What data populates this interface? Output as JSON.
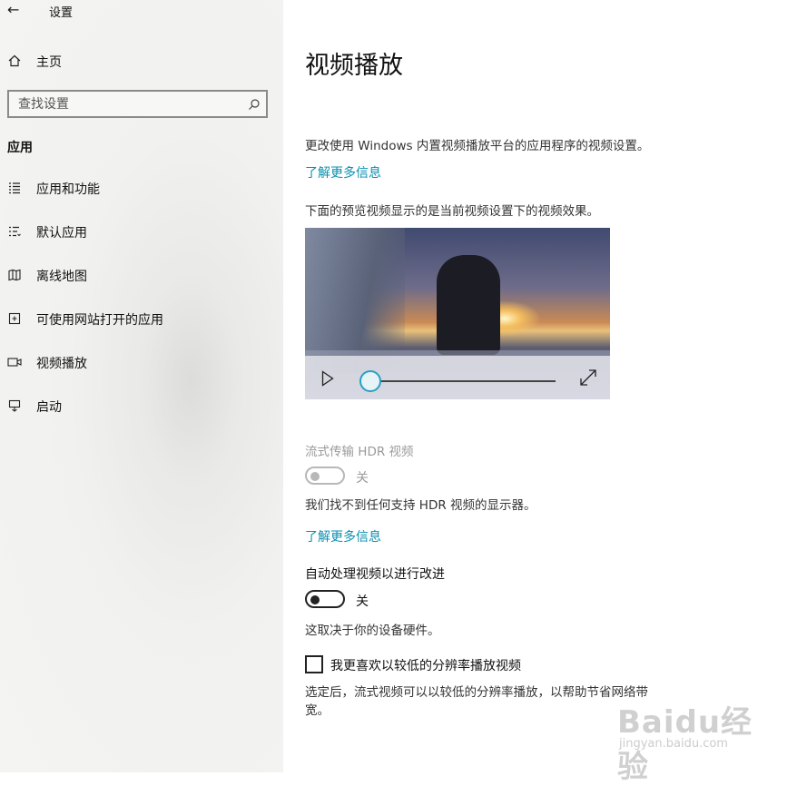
{
  "window": {
    "title": "设置"
  },
  "sidebar": {
    "home_label": "主页",
    "search": {
      "placeholder": "查找设置",
      "value": ""
    },
    "section_title": "应用",
    "items": [
      {
        "label": "应用和功能",
        "icon": "list-icon"
      },
      {
        "label": "默认应用",
        "icon": "default-apps-icon"
      },
      {
        "label": "离线地图",
        "icon": "map-icon"
      },
      {
        "label": "可使用网站打开的应用",
        "icon": "open-external-icon"
      },
      {
        "label": "视频播放",
        "icon": "video-icon"
      },
      {
        "label": "启动",
        "icon": "startup-icon"
      }
    ]
  },
  "main": {
    "title": "视频播放",
    "description": "更改使用 Windows 内置视频播放平台的应用程序的视频设置。",
    "learn_more_1": "了解更多信息",
    "preview_text": "下面的预览视频显示的是当前视频设置下的视频效果。",
    "hdr": {
      "label": "流式传输 HDR 视频",
      "toggle_state": "关",
      "note": "我们找不到任何支持 HDR 视频的显示器。",
      "learn_more": "了解更多信息"
    },
    "auto_process": {
      "label": "自动处理视频以进行改进",
      "toggle_state": "关",
      "note": "这取决于你的设备硬件。"
    },
    "low_res": {
      "label": "我更喜欢以较低的分辨率播放视频",
      "checked": false,
      "note_line1": "选定后，流式视频可以以较低的分辨率播放，以帮助节省网络带",
      "note_line2": "宽。"
    },
    "player": {
      "progress": 0
    }
  },
  "watermark": {
    "brand": "Baidu经验",
    "url": "jingyan.baidu.com"
  },
  "colors": {
    "link": "#0a8fb0",
    "accent": "#2a9fc4"
  }
}
